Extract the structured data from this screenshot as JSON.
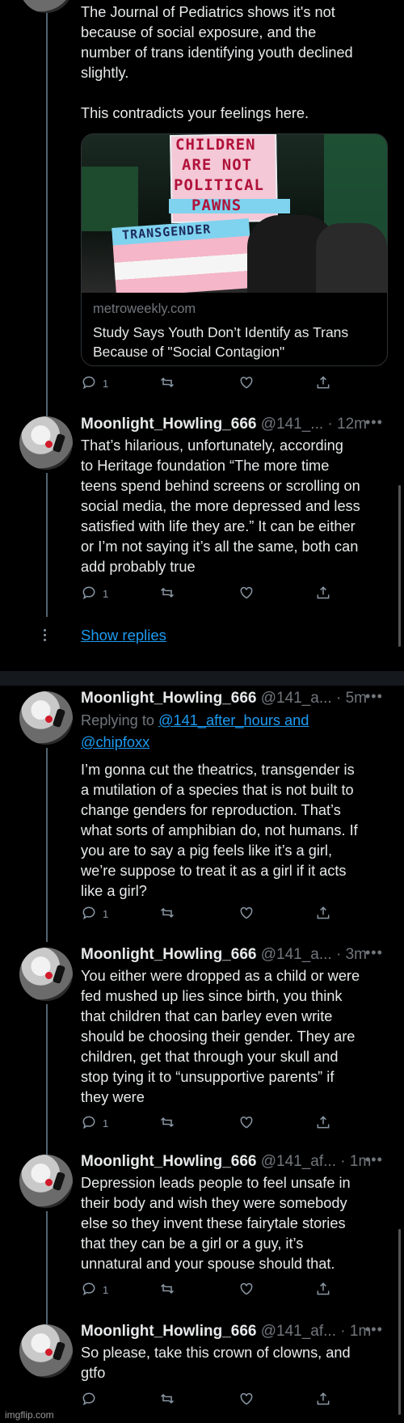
{
  "tweets": [
    {
      "id": "t0",
      "text": "The Journal of Pediatrics shows it's not\nbecause of social exposure, and the\nnumber of trans identifying youth declined\nslightly.\n\nThis contradicts your feelings here.",
      "card": {
        "image_sign_lines": [
          "CHILDREN",
          "ARE NOT",
          "POLITICAL",
          "PAWNS"
        ],
        "image_banner": "TRANSGENDER",
        "domain": "metroweekly.com",
        "title": "Study Says Youth Don’t Identify as Trans Because of \"Social Contagion\""
      },
      "reply_count": "1"
    },
    {
      "id": "t1",
      "name": "Moonlight_Howling_666",
      "handle": "@141_...",
      "time": "· 12m",
      "text": "That’s hilarious, unfortunately, according\nto Heritage foundation “The more time\nteens spend behind screens or scrolling on\nsocial media, the more depressed and less\nsatisfied with life they are.” It can be either\nor I’m not saying it’s all the same, both can\nadd probably true",
      "reply_count": "1"
    },
    {
      "id": "t2",
      "name": "Moonlight_Howling_666",
      "handle": "@141_a...",
      "time": "· 5m",
      "replying_prefix": "Replying to",
      "replying_to": "@141_after_hours and\n@chipfoxx",
      "text": "I’m gonna cut the theatrics, transgender is\na mutilation of a species that is not built to\nchange genders for reproduction. That’s\nwhat sorts of amphibian do, not humans. If\nyou are to say a pig feels like it’s a girl,\nwe’re suppose to treat it as a girl if it acts\nlike a girl?",
      "reply_count": "1"
    },
    {
      "id": "t3",
      "name": "Moonlight_Howling_666",
      "handle": "@141_a...",
      "time": "· 3m",
      "text": "You either were dropped as a child or were\nfed mushed up lies since birth, you think\nthat children that can barley even write\nshould be choosing their gender. They are\nchildren, get that through your skull and\nstop tying it to “unsupportive parents” if\nthey were",
      "reply_count": "1"
    },
    {
      "id": "t4",
      "name": "Moonlight_Howling_666",
      "handle": "@141_af...",
      "time": "· 1m",
      "text": "Depression leads people to feel unsafe in\ntheir body and wish they were somebody\nelse so they invent these fairytale stories\nthat they can be a girl or a guy, it’s\nunnatural and your spouse should that.",
      "reply_count": "1"
    },
    {
      "id": "t5",
      "name": "Moonlight_Howling_666",
      "handle": "@141_af...",
      "time": "· 1m",
      "text": "So please, take this crown of clowns, and\ngtfo",
      "reply_count": ""
    }
  ],
  "show_replies": "Show replies",
  "more_glyph": "•••",
  "watermark": "imgflip.com",
  "icons": [
    "reply-icon",
    "retweet-icon",
    "like-icon",
    "share-icon"
  ],
  "colors": {
    "link": "#1d9bf0",
    "muted": "#71767b",
    "background": "#000000",
    "text": "#e7e9ea"
  }
}
